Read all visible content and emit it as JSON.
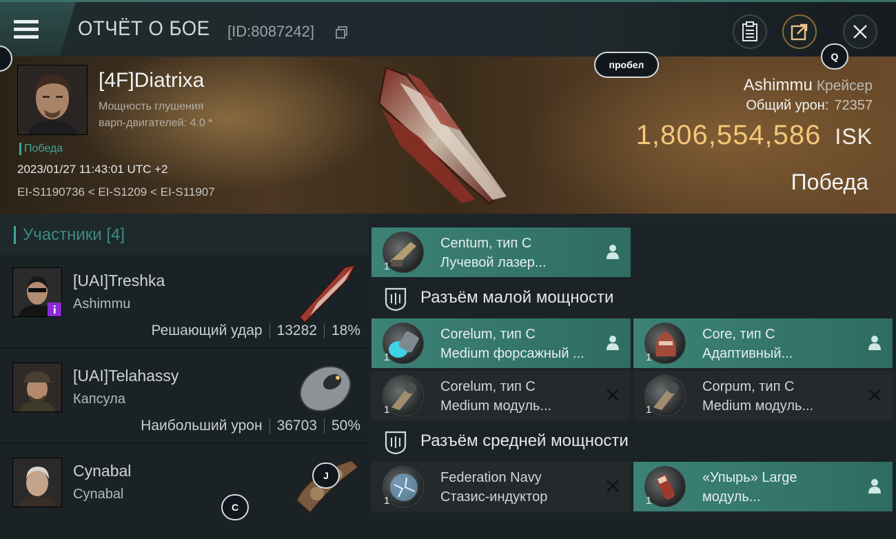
{
  "header": {
    "title": "ОТЧЁТ О БОЕ",
    "battle_id": "[ID:8087242]",
    "icons": [
      "menu-icon",
      "copy-icon",
      "clipboard-icon",
      "share-icon",
      "close-icon"
    ]
  },
  "hotkeys": {
    "space": "пробел",
    "q": "Q",
    "j": "J",
    "c": "C"
  },
  "killer": {
    "name": "[4F]Diatrixa",
    "info_line1": "Мощность глушения",
    "info_line2": "варп-двигателей: 4.0 *",
    "result_tag": "Победа",
    "timestamp": "2023/01/27 11:43:01 UTC +2",
    "location": "EI-S1190736 < EI-S1209 < EI-S11907"
  },
  "victim": {
    "ship": "Ashimmu",
    "ship_class": "Крейсер",
    "total_damage_label": "Общий урон:",
    "total_damage": "72357",
    "isk_value": "1,806,554,586",
    "isk_unit": "ISK",
    "result": "Победа"
  },
  "participants": {
    "title": "Участники [4]",
    "list": [
      {
        "name": "[UAI]Treshka",
        "ship": "Ashimmu",
        "stat_label": "Решающий удар",
        "damage": "13282",
        "percent": "18%"
      },
      {
        "name": "[UAI]Telahassy",
        "ship": "Капсула",
        "stat_label": "Наибольший урон",
        "damage": "36703",
        "percent": "50%"
      },
      {
        "name": "Cynabal",
        "ship": "Cynabal"
      }
    ]
  },
  "fitting": {
    "top_slot": {
      "qty": "1",
      "name": "Centum, тип C",
      "type": "Лучевой лазер...",
      "status": "user-icon"
    },
    "low_section": "Разъём малой мощности",
    "low_slots": [
      {
        "qty": "1",
        "name": "Corelum, тип C",
        "type": "Medium форсажный ...",
        "status": "user-icon",
        "active": true
      },
      {
        "qty": "1",
        "name": "Core, тип C",
        "type": "Адаптивный...",
        "status": "user-icon",
        "active": true
      },
      {
        "qty": "1",
        "name": "Corelum, тип C",
        "type": "Medium модуль...",
        "status": "close-icon",
        "active": false
      },
      {
        "qty": "1",
        "name": "Corpum, тип C",
        "type": "Medium модуль...",
        "status": "close-icon",
        "active": false
      }
    ],
    "mid_section": "Разъём средней мощности",
    "mid_slots": [
      {
        "qty": "1",
        "name": "Federation Navy",
        "type": "Стазис-индуктор",
        "status": "close-icon",
        "active": false
      },
      {
        "qty": "1",
        "name": "«Упырь» Large",
        "type": "модуль...",
        "status": "user-icon",
        "active": true
      }
    ]
  },
  "colors": {
    "accent_teal": "#3fa89a",
    "isk_gold": "#f2c777",
    "active_slot": "#3c8276"
  }
}
